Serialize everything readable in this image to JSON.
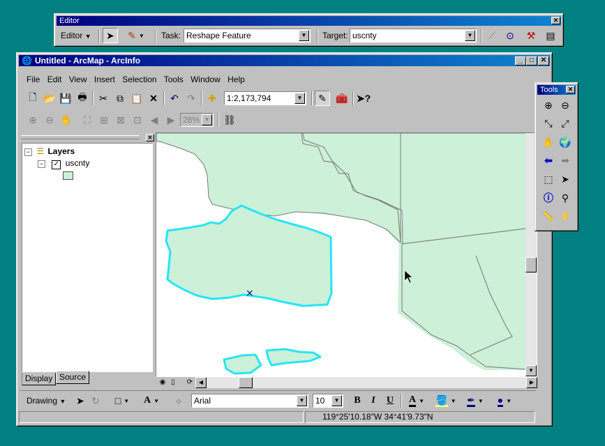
{
  "editor_toolbar": {
    "title": "Editor",
    "menu_label": "Editor",
    "task_label": "Task:",
    "task_value": "Reshape Feature",
    "target_label": "Target:",
    "target_value": "uscnty"
  },
  "arcmap": {
    "title": "Untitled - ArcMap - ArcInfo",
    "menu": {
      "file": "File",
      "edit": "Edit",
      "view": "View",
      "insert": "Insert",
      "selection": "Selection",
      "tools": "Tools",
      "window": "Window",
      "help": "Help"
    },
    "scale_value": "1:2,173,794",
    "zoom_value": "28%"
  },
  "toc": {
    "root": "Layers",
    "layer": "uscnty",
    "tabs": {
      "display": "Display",
      "source": "Source"
    }
  },
  "drawing_toolbar": {
    "menu_label": "Drawing",
    "font_value": "Arial",
    "size_value": "10",
    "bold": "B",
    "italic": "I",
    "underline": "U"
  },
  "status_bar": {
    "coordinates": "119°25'10.18\"W  34°41'9.73\"N"
  },
  "tools_window": {
    "title": "Tools"
  },
  "colors": {
    "desktop": "#008080",
    "polygon_fill": "#ccf0d8",
    "selection_outline": "#26e5f5"
  }
}
